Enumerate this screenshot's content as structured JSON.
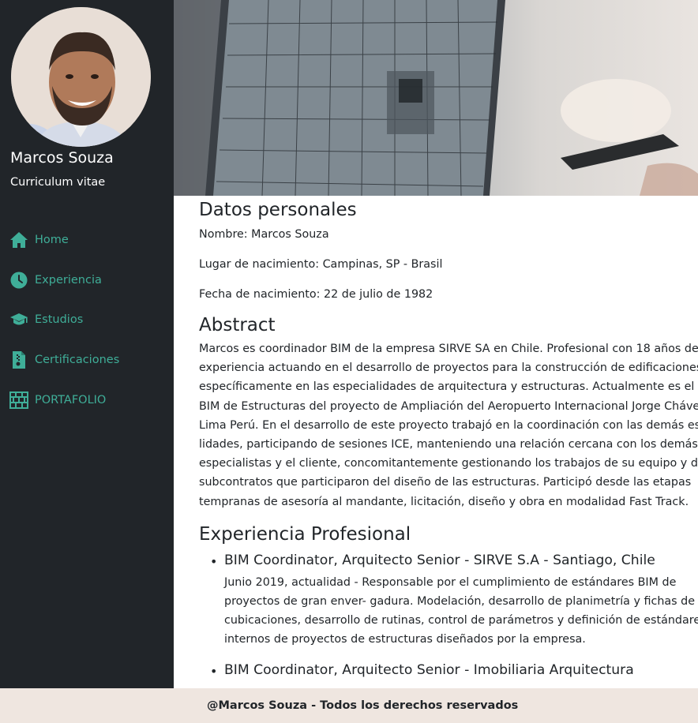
{
  "profile": {
    "name": "Marcos Souza",
    "subtitle": "Curriculum vitae"
  },
  "nav": {
    "items": [
      {
        "label": "Home",
        "icon": "home-icon"
      },
      {
        "label": "Experiencia",
        "icon": "clock-icon"
      },
      {
        "label": "Estudios",
        "icon": "graduation-cap-icon"
      },
      {
        "label": "Certificaciones",
        "icon": "certificate-file-icon"
      },
      {
        "label": "PORTAFOLIO",
        "icon": "brick-wall-icon"
      }
    ],
    "color": "#3fae98"
  },
  "personal": {
    "heading": "Datos personales",
    "nombre": "Nombre: Marcos Souza",
    "lugar": "Lugar de nacimiento: Campinas, SP - Brasil",
    "fecha": "Fecha de nacimiento: 22 de julio de 1982"
  },
  "abstract": {
    "heading": "Abstract",
    "lines": [
      "Marcos es coordinador BIM de la empresa SIRVE SA en Chile. Profesional con 18 años de",
      "experiencia actuando en el desarrollo de proyectos para la construcción de edificaciones,",
      "específicamente en las especialidades de arquitectura y estructuras. Actualmente es el Líder",
      "BIM de Estructuras del proyecto de Ampliación del Aeropuerto Internacional Jorge Chávez,",
      "Lima Perú. En el desarrollo de este proyecto trabajó en la coordinación con las demás especia-",
      "lidades, participando de sesiones ICE, manteniendo una relación cercana con los demás",
      "especialistas y el cliente, concomitantemente gestionando los trabajos de su equipo y de los",
      "subcontratos que participaron del diseño de las estructuras. Participó desde las etapas",
      "tempranas de asesoría al mandante, licitación, diseño y obra en modalidad Fast Track."
    ]
  },
  "experience": {
    "heading": "Experiencia Profesional",
    "jobs": [
      {
        "title": "BIM Coordinator, Arquitecto Senior - SIRVE S.A - Santiago, Chile",
        "lines": [
          "Junio 2019, actualidad - Responsable por el cumplimiento de estándares BIM de",
          "proyectos de gran enver- gadura. Modelación, desarrollo de planimetría y fichas de obra,",
          "cubicaciones, desarrollo de rutinas, control de parámetros y definición de estándares",
          "internos de proyectos de estructuras diseñados por la empresa."
        ]
      },
      {
        "title": "BIM Coordinator, Arquitecto Senior - Imobiliaria Arquitectura",
        "lines": []
      }
    ]
  },
  "footer": {
    "text": "@Marcos Souza - Todos los derechos reservados"
  }
}
